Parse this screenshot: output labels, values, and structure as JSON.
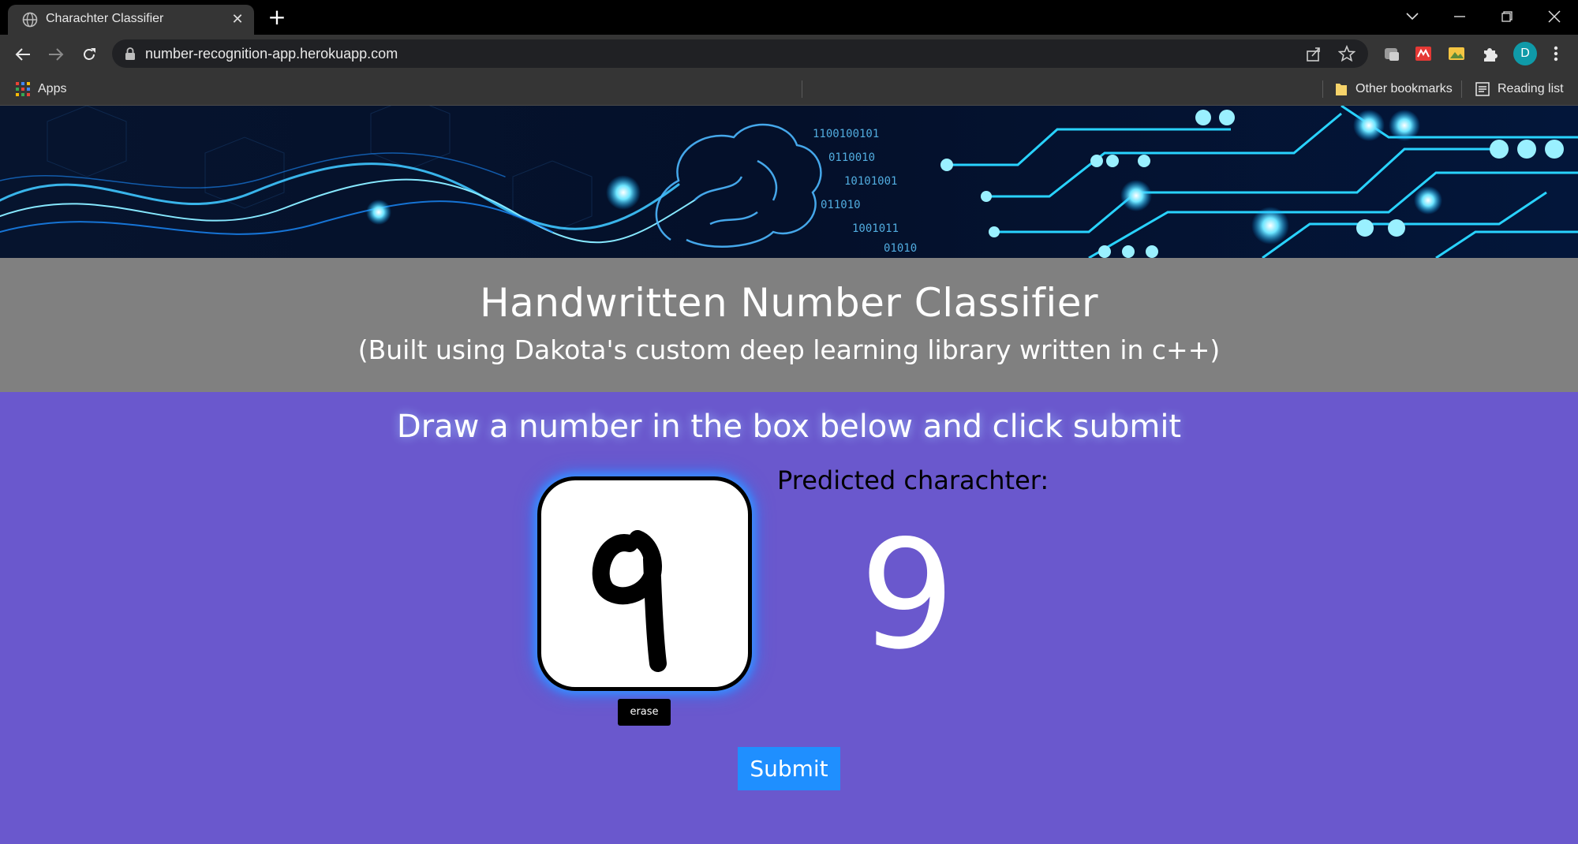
{
  "browser": {
    "tab_title": "Charachter Classifier",
    "tab_close": "✕",
    "new_tab": "+",
    "url": "number-recognition-app.herokuapp.com",
    "profile_initial": "D",
    "bookmarks": {
      "apps_label": "Apps",
      "other_label": "Other bookmarks",
      "reading_label": "Reading list"
    }
  },
  "page": {
    "title": "Handwritten Number Classifier",
    "subtitle": "(Built using Dakota's custom deep learning library written in c++)",
    "instructions": "Draw a number in the box below and click submit",
    "erase_label": "erase",
    "predicted_label": "Predicted charachter:",
    "predicted_value": "9",
    "submit_label": "Submit"
  },
  "colors": {
    "page_background": "#6a58cd",
    "header_background": "#808080",
    "submit_button": "#1f8fff",
    "canvas_glow": "#3a8dff"
  }
}
